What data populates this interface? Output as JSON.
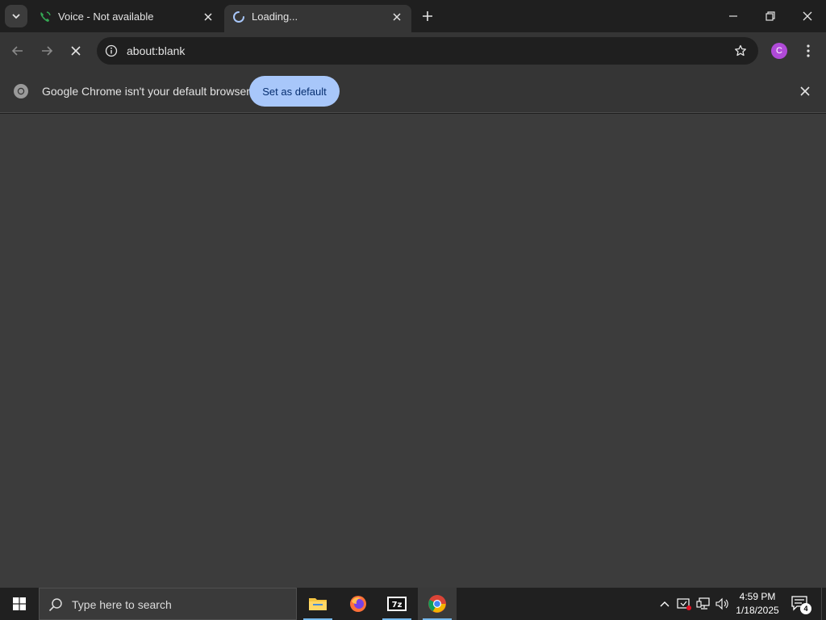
{
  "tabs": [
    {
      "title": "Voice - Not available",
      "icon": "phone-icon",
      "active": false
    },
    {
      "title": "Loading...",
      "icon": "loading-spinner-icon",
      "active": true
    }
  ],
  "toolbar": {
    "url": "about:blank",
    "profile_initial": "C"
  },
  "infobar": {
    "message": "Google Chrome isn't your default browser",
    "button_label": "Set as default"
  },
  "taskbar": {
    "search_placeholder": "Type here to search",
    "apps": [
      "file-explorer-icon",
      "firefox-icon",
      "7zip-icon",
      "chrome-icon"
    ],
    "time": "4:59 PM",
    "date": "1/18/2025",
    "notification_count": "4"
  },
  "colors": {
    "accent": "#a8c7fa",
    "content_bg": "#3c3c3c",
    "avatar": "#b04ad8"
  }
}
